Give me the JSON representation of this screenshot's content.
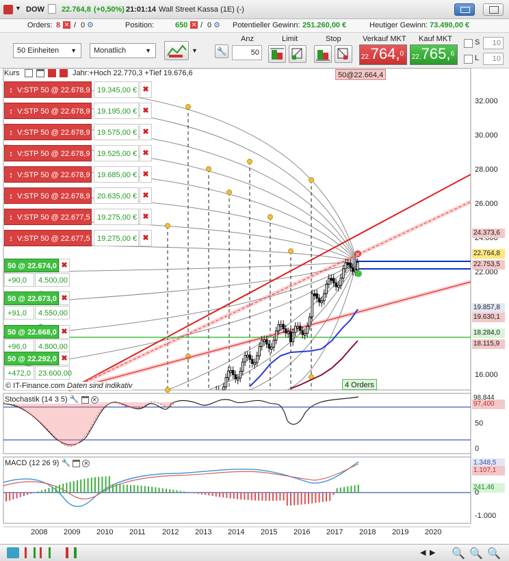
{
  "header": {
    "symbol": "DOW",
    "price": "22.764,8",
    "change": "(+0,50%)",
    "time": "21:01:14",
    "market": "Wall Street Kassa (1E) (-)"
  },
  "infobar": {
    "orders_label": "Orders:",
    "orders_count": "8",
    "orders_zero": "0",
    "position_label": "Position:",
    "position_value": "650",
    "position_zero": "0",
    "pot_gain_label": "Potentieller Gewinn:",
    "pot_gain_value": "251.260,00 €",
    "today_gain_label": "Heutiger Gewinn:",
    "today_gain_value": "73.490,00 €"
  },
  "toolbar": {
    "units_select": "50 Einheiten",
    "period_select": "Monatlich",
    "anz_label": "Anz",
    "anz_value": "50",
    "limit_label": "Limit",
    "stop_label": "Stop",
    "sell_label": "Verkauf MKT",
    "buy_label": "Kauf MKT",
    "sell_prefix": "22.",
    "sell_main": "764,",
    "sell_sup": "0",
    "buy_prefix": "22.",
    "buy_main": "765,",
    "buy_sup": "6",
    "s_label": "S",
    "s_value": "10",
    "l_label": "L",
    "l_value": "10"
  },
  "chart": {
    "legend_label": "Kurs",
    "year_info": "Jahr:+Hoch 22.770,3 +Tief 19.676,6",
    "top_tag": "50@22.664,4",
    "copyright": "© IT-Finance.com",
    "indicative": "Daten sind indikativ",
    "orders_badge": "4 Orders",
    "stop_orders": [
      {
        "label": "V:STP  50 @ 22.678,9",
        "value": "19.345,00 €"
      },
      {
        "label": "V:STP  50 @ 22.678,9",
        "value": "19.195,00 €"
      },
      {
        "label": "V:STP  50 @ 22.678,9",
        "value": "19.575,00 €"
      },
      {
        "label": "V:STP  50 @ 22.678,9",
        "value": "19.525,00 €"
      },
      {
        "label": "V:STP  50 @ 22.678,9",
        "value": "19.685,00 €"
      },
      {
        "label": "V:STP  50 @ 22.678,9",
        "value": "20.635,00 €"
      },
      {
        "label": "V:STP  50 @ 22.677,5",
        "value": "19.275,00 €"
      },
      {
        "label": "V:STP  50 @ 22.677,5",
        "value": "19.275,00 €"
      }
    ],
    "positions": [
      {
        "label": "50 @ 22.674,0",
        "pts": "+90,0",
        "value": "4.500,00 €"
      },
      {
        "label": "50 @ 22.673,0",
        "pts": "+91,0",
        "value": "4.550,00 €"
      },
      {
        "label": "50 @ 22.668,0",
        "pts": "+96,0",
        "value": "4.800,00 €"
      },
      {
        "label": "50 @ 22.292,0",
        "pts": "+472,0",
        "value": "23.600,00 €"
      }
    ],
    "price_axis": [
      "32.000",
      "30.000",
      "28.000",
      "26.000",
      "24.000",
      "22.000",
      "16.000"
    ],
    "price_tags": [
      {
        "text": "24.373,6",
        "color": "#f2c8c8"
      },
      {
        "text": "22.764,8",
        "color": "#ffe680"
      },
      {
        "text": "22.753,5",
        "color": "#f2c8c8"
      },
      {
        "text": "19.857,8",
        "color": "#e3e6f5"
      },
      {
        "text": "19.630,1",
        "color": "#f2c8c8"
      },
      {
        "text": "18.284,0",
        "color": "#d8f5d8"
      },
      {
        "text": "18.115,9",
        "color": "#f2c8c8"
      }
    ]
  },
  "stochastic": {
    "label": "Stochastik (14 3 5)",
    "axis": [
      "50",
      "0"
    ],
    "tag": "97,400",
    "tag_top": "98,844"
  },
  "macd": {
    "label": "MACD (12 26 9)",
    "axis": [
      "0",
      "-1.000"
    ],
    "tag1": "1.348,5",
    "tag2": "1.107,1",
    "tag3": "241,46"
  },
  "time_axis": [
    "2008",
    "2009",
    "2010",
    "2011",
    "2012",
    "2013",
    "2014",
    "2015",
    "2016",
    "2017",
    "2018",
    "2019",
    "2020"
  ]
}
